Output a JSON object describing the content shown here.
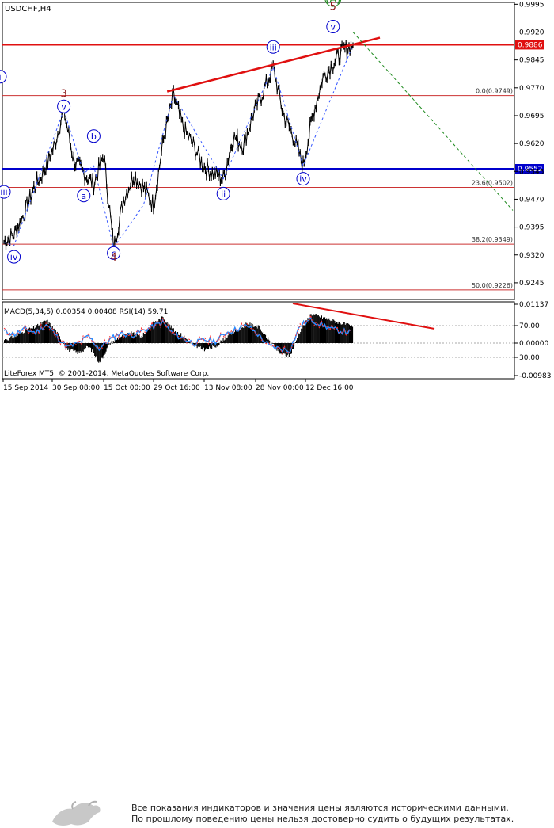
{
  "symbol_label": "USDCHF,H4",
  "indicator_label": "MACD(5,34,5) 0.00354 0.00408 RSI(14) 59.71",
  "copyright": "LiteForex MT5, © 2001-2014, MetaQuotes Software Corp.",
  "disclaimer": {
    "line1": "Все показания индикаторов и значения цены являются историческими данными.",
    "line2": "По прошлому поведению цены нельзя достоверно судить о будущих результатах."
  },
  "colors": {
    "blue": "#0000cc",
    "red": "#e01010",
    "brown": "#8b1a1a",
    "green": "#1e8a1e",
    "line_dashed_blue": "#3355ff"
  },
  "chart_data": [
    {
      "type": "line",
      "title": "USDCHF,H4",
      "ylim": [
        0.92,
        0.9995
      ],
      "y_ticks": [
        "0.9995",
        "0.9920",
        "0.9845",
        "0.9770",
        "0.9695",
        "0.9620",
        "0.9545",
        "0.9470",
        "0.9395",
        "0.9320",
        "0.9245"
      ],
      "x_ticks": [
        "15 Sep 2014",
        "30 Sep 08:00",
        "15 Oct 00:00",
        "29 Oct 16:00",
        "13 Nov 08:00",
        "28 Nov 00:00",
        "12 Dec 16:00"
      ],
      "series": [
        {
          "x": [
            "15 Sep",
            "18 Sep",
            "22 Sep",
            "24 Sep",
            "26 Sep",
            "29 Sep",
            "1 Oct",
            "3 Oct",
            "6 Oct",
            "8 Oct",
            "10 Oct",
            "14 Oct",
            "16 Oct",
            "20 Oct",
            "22 Oct",
            "24 Oct",
            "28 Oct",
            "30 Oct",
            "3 Nov",
            "5 Nov",
            "7 Nov",
            "11 Nov",
            "13 Nov",
            "17 Nov",
            "19 Nov",
            "21 Nov",
            "25 Nov",
            "27 Nov",
            "1 Dec",
            "3 Dec",
            "5 Dec",
            "9 Dec",
            "11 Dec",
            "15 Dec",
            "17 Dec",
            "19 Dec"
          ],
          "values": [
            0.9355,
            0.9375,
            0.943,
            0.95,
            0.9545,
            0.961,
            0.971,
            0.9575,
            0.954,
            0.951,
            0.959,
            0.934,
            0.947,
            0.9535,
            0.95,
            0.9455,
            0.963,
            0.975,
            0.966,
            0.9615,
            0.956,
            0.954,
            0.9525,
            0.964,
            0.9615,
            0.97,
            0.976,
            0.9825,
            0.97,
            0.964,
            0.956,
            0.97,
            0.98,
            0.9835,
            0.987,
            0.9885
          ]
        }
      ],
      "horizontal_lines": [
        {
          "label": "0.9886",
          "value": 0.9886,
          "color": "#e01010"
        },
        {
          "label": "0.9552",
          "value": 0.9552,
          "color": "#0000cc"
        },
        {
          "label": "0.0(0.9749)",
          "value": 0.9749,
          "color": "#cc3333"
        },
        {
          "label": "23.6(0.9502)",
          "value": 0.9502,
          "color": "#cc3333"
        },
        {
          "label": "38.2(0.9349)",
          "value": 0.9349,
          "color": "#cc3333"
        },
        {
          "label": "50.0(0.9226)",
          "value": 0.9226,
          "color": "#cc3333"
        }
      ],
      "wave_labels": [
        {
          "text": "iii",
          "x": "15 Sep",
          "y": 0.949,
          "color": "#0000cc",
          "circle": true
        },
        {
          "text": "iv",
          "x": "18 Sep",
          "y": 0.9315,
          "color": "#0000cc",
          "circle": true
        },
        {
          "text": "3",
          "x": "1 Oct",
          "y": 0.9745,
          "color": "#8b1a1a",
          "circle": false
        },
        {
          "text": "v",
          "x": "1 Oct",
          "y": 0.972,
          "color": "#0000cc",
          "circle": true
        },
        {
          "text": "b",
          "x": "8 Oct",
          "y": 0.964,
          "color": "#0000cc",
          "circle": true
        },
        {
          "text": "a",
          "x": "6 Oct",
          "y": 0.948,
          "color": "#0000cc",
          "circle": true
        },
        {
          "text": "c",
          "x": "14 Oct",
          "y": 0.9325,
          "color": "#0000cc",
          "circle": true
        },
        {
          "text": "4",
          "x": "14 Oct",
          "y": 0.9305,
          "color": "#8b1a1a",
          "circle": false
        },
        {
          "text": "i",
          "x": "29 Oct",
          "y": 0.98,
          "color": "#0000cc",
          "circle": true
        },
        {
          "text": "ii",
          "x": "13 Nov",
          "y": 0.9485,
          "color": "#0000cc",
          "circle": true
        },
        {
          "text": "iii",
          "x": "27 Nov",
          "y": 0.988,
          "color": "#0000cc",
          "circle": true
        },
        {
          "text": "iv",
          "x": "5 Dec",
          "y": 0.9525,
          "color": "#0000cc",
          "circle": true
        },
        {
          "text": "v",
          "x": "15 Dec",
          "y": 0.9935,
          "color": "#0000cc",
          "circle": true
        },
        {
          "text": "5",
          "x": "15 Dec",
          "y": 0.998,
          "color": "#8b1a1a",
          "circle": false
        },
        {
          "text": "(A)",
          "x": "15 Dec",
          "y": 1.0,
          "color": "#1e8a1e",
          "circle": false
        }
      ]
    },
    {
      "type": "line",
      "title": "MACD(5,34,5) 0.00354 0.00408 RSI(14) 59.71",
      "y_ticks": [
        "0.01137",
        "70.00",
        "0.00000",
        "30.00",
        "-0.00983"
      ],
      "series": [
        {
          "name": "MACD",
          "values": [
            0.001,
            0.002,
            0.004,
            0.005,
            0.007,
            0.003,
            -0.002,
            -0.003,
            -0.001,
            -0.006,
            0.0,
            0.002,
            0.003,
            0.002,
            0.006,
            0.008,
            0.004,
            0.002,
            -0.001,
            -0.002,
            -0.001,
            0.002,
            0.004,
            0.006,
            0.005,
            0.001,
            -0.003,
            -0.004,
            0.004,
            0.009,
            0.008,
            0.007,
            0.006,
            0.005
          ]
        },
        {
          "name": "RSI",
          "values": [
            62,
            58,
            65,
            60,
            72,
            55,
            40,
            45,
            55,
            38,
            50,
            60,
            56,
            62,
            68,
            75,
            58,
            52,
            45,
            50,
            48,
            60,
            65,
            70,
            58,
            42,
            38,
            35,
            70,
            78,
            72,
            65,
            62,
            60
          ]
        }
      ]
    }
  ]
}
